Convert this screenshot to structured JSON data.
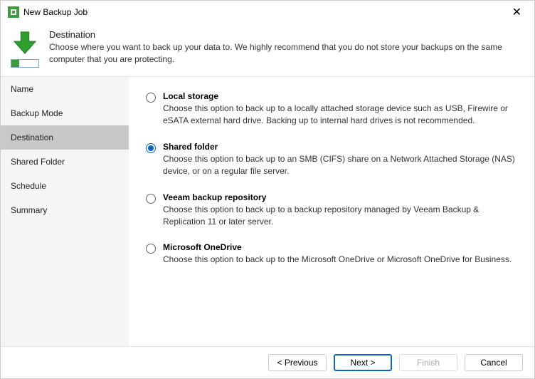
{
  "window": {
    "title": "New Backup Job"
  },
  "header": {
    "title": "Destination",
    "description": "Choose where you want to back up your data to. We highly recommend that you do not store your backups on the same computer that you are protecting."
  },
  "sidebar": {
    "items": [
      {
        "label": "Name"
      },
      {
        "label": "Backup Mode"
      },
      {
        "label": "Destination"
      },
      {
        "label": "Shared Folder"
      },
      {
        "label": "Schedule"
      },
      {
        "label": "Summary"
      }
    ],
    "active_index": 2
  },
  "options": [
    {
      "title": "Local storage",
      "selected": false,
      "description": "Choose this option to back up to a locally attached storage device such as USB, Firewire or eSATA external hard drive. Backing up to internal hard drives is not recommended."
    },
    {
      "title": "Shared folder",
      "selected": true,
      "description": "Choose this option to back up to an SMB (CIFS) share on a Network Attached Storage (NAS) device, or on a regular file server."
    },
    {
      "title": "Veeam backup repository",
      "selected": false,
      "description": "Choose this option to back up to a backup repository managed by Veeam Backup & Replication 11 or later server."
    },
    {
      "title": "Microsoft OneDrive",
      "selected": false,
      "description": "Choose this option to back up to the Microsoft OneDrive or Microsoft OneDrive for Business."
    }
  ],
  "footer": {
    "previous": "< Previous",
    "next": "Next >",
    "finish": "Finish",
    "cancel": "Cancel"
  }
}
